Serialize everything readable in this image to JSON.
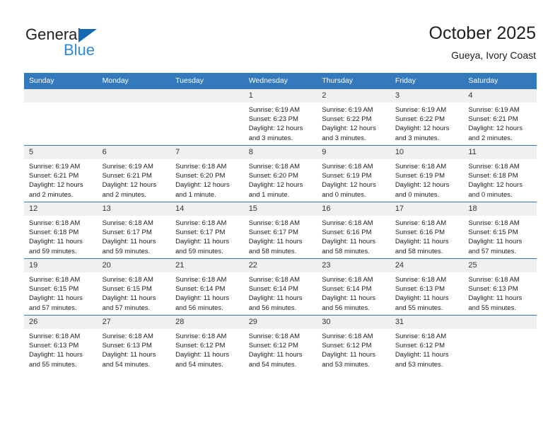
{
  "logo": {
    "line1": "General",
    "line2": "Blue",
    "triangle_color": "#1668b3",
    "line2_color": "#2e8bd8"
  },
  "header": {
    "title": "October 2025",
    "subtitle": "Gueya, Ivory Coast"
  },
  "colors": {
    "header_blue": "#3479bb",
    "daynum_band": "#f0f0f0",
    "text": "#222222"
  },
  "weekday_headers": [
    "Sunday",
    "Monday",
    "Tuesday",
    "Wednesday",
    "Thursday",
    "Friday",
    "Saturday"
  ],
  "labels": {
    "sunrise_prefix": "Sunrise:",
    "sunset_prefix": "Sunset:",
    "daylight_prefix": "Daylight:"
  },
  "weeks": [
    [
      {
        "day": "",
        "empty": true
      },
      {
        "day": "",
        "empty": true
      },
      {
        "day": "",
        "empty": true
      },
      {
        "day": "1",
        "sunrise": "Sunrise: 6:19 AM",
        "sunset": "Sunset: 6:23 PM",
        "daylight_line1": "Daylight: 12 hours",
        "daylight_line2": "and 3 minutes."
      },
      {
        "day": "2",
        "sunrise": "Sunrise: 6:19 AM",
        "sunset": "Sunset: 6:22 PM",
        "daylight_line1": "Daylight: 12 hours",
        "daylight_line2": "and 3 minutes."
      },
      {
        "day": "3",
        "sunrise": "Sunrise: 6:19 AM",
        "sunset": "Sunset: 6:22 PM",
        "daylight_line1": "Daylight: 12 hours",
        "daylight_line2": "and 3 minutes."
      },
      {
        "day": "4",
        "sunrise": "Sunrise: 6:19 AM",
        "sunset": "Sunset: 6:21 PM",
        "daylight_line1": "Daylight: 12 hours",
        "daylight_line2": "and 2 minutes."
      }
    ],
    [
      {
        "day": "5",
        "sunrise": "Sunrise: 6:19 AM",
        "sunset": "Sunset: 6:21 PM",
        "daylight_line1": "Daylight: 12 hours",
        "daylight_line2": "and 2 minutes."
      },
      {
        "day": "6",
        "sunrise": "Sunrise: 6:19 AM",
        "sunset": "Sunset: 6:21 PM",
        "daylight_line1": "Daylight: 12 hours",
        "daylight_line2": "and 2 minutes."
      },
      {
        "day": "7",
        "sunrise": "Sunrise: 6:18 AM",
        "sunset": "Sunset: 6:20 PM",
        "daylight_line1": "Daylight: 12 hours",
        "daylight_line2": "and 1 minute."
      },
      {
        "day": "8",
        "sunrise": "Sunrise: 6:18 AM",
        "sunset": "Sunset: 6:20 PM",
        "daylight_line1": "Daylight: 12 hours",
        "daylight_line2": "and 1 minute."
      },
      {
        "day": "9",
        "sunrise": "Sunrise: 6:18 AM",
        "sunset": "Sunset: 6:19 PM",
        "daylight_line1": "Daylight: 12 hours",
        "daylight_line2": "and 0 minutes."
      },
      {
        "day": "10",
        "sunrise": "Sunrise: 6:18 AM",
        "sunset": "Sunset: 6:19 PM",
        "daylight_line1": "Daylight: 12 hours",
        "daylight_line2": "and 0 minutes."
      },
      {
        "day": "11",
        "sunrise": "Sunrise: 6:18 AM",
        "sunset": "Sunset: 6:18 PM",
        "daylight_line1": "Daylight: 12 hours",
        "daylight_line2": "and 0 minutes."
      }
    ],
    [
      {
        "day": "12",
        "sunrise": "Sunrise: 6:18 AM",
        "sunset": "Sunset: 6:18 PM",
        "daylight_line1": "Daylight: 11 hours",
        "daylight_line2": "and 59 minutes."
      },
      {
        "day": "13",
        "sunrise": "Sunrise: 6:18 AM",
        "sunset": "Sunset: 6:17 PM",
        "daylight_line1": "Daylight: 11 hours",
        "daylight_line2": "and 59 minutes."
      },
      {
        "day": "14",
        "sunrise": "Sunrise: 6:18 AM",
        "sunset": "Sunset: 6:17 PM",
        "daylight_line1": "Daylight: 11 hours",
        "daylight_line2": "and 59 minutes."
      },
      {
        "day": "15",
        "sunrise": "Sunrise: 6:18 AM",
        "sunset": "Sunset: 6:17 PM",
        "daylight_line1": "Daylight: 11 hours",
        "daylight_line2": "and 58 minutes."
      },
      {
        "day": "16",
        "sunrise": "Sunrise: 6:18 AM",
        "sunset": "Sunset: 6:16 PM",
        "daylight_line1": "Daylight: 11 hours",
        "daylight_line2": "and 58 minutes."
      },
      {
        "day": "17",
        "sunrise": "Sunrise: 6:18 AM",
        "sunset": "Sunset: 6:16 PM",
        "daylight_line1": "Daylight: 11 hours",
        "daylight_line2": "and 58 minutes."
      },
      {
        "day": "18",
        "sunrise": "Sunrise: 6:18 AM",
        "sunset": "Sunset: 6:15 PM",
        "daylight_line1": "Daylight: 11 hours",
        "daylight_line2": "and 57 minutes."
      }
    ],
    [
      {
        "day": "19",
        "sunrise": "Sunrise: 6:18 AM",
        "sunset": "Sunset: 6:15 PM",
        "daylight_line1": "Daylight: 11 hours",
        "daylight_line2": "and 57 minutes."
      },
      {
        "day": "20",
        "sunrise": "Sunrise: 6:18 AM",
        "sunset": "Sunset: 6:15 PM",
        "daylight_line1": "Daylight: 11 hours",
        "daylight_line2": "and 57 minutes."
      },
      {
        "day": "21",
        "sunrise": "Sunrise: 6:18 AM",
        "sunset": "Sunset: 6:14 PM",
        "daylight_line1": "Daylight: 11 hours",
        "daylight_line2": "and 56 minutes."
      },
      {
        "day": "22",
        "sunrise": "Sunrise: 6:18 AM",
        "sunset": "Sunset: 6:14 PM",
        "daylight_line1": "Daylight: 11 hours",
        "daylight_line2": "and 56 minutes."
      },
      {
        "day": "23",
        "sunrise": "Sunrise: 6:18 AM",
        "sunset": "Sunset: 6:14 PM",
        "daylight_line1": "Daylight: 11 hours",
        "daylight_line2": "and 56 minutes."
      },
      {
        "day": "24",
        "sunrise": "Sunrise: 6:18 AM",
        "sunset": "Sunset: 6:13 PM",
        "daylight_line1": "Daylight: 11 hours",
        "daylight_line2": "and 55 minutes."
      },
      {
        "day": "25",
        "sunrise": "Sunrise: 6:18 AM",
        "sunset": "Sunset: 6:13 PM",
        "daylight_line1": "Daylight: 11 hours",
        "daylight_line2": "and 55 minutes."
      }
    ],
    [
      {
        "day": "26",
        "sunrise": "Sunrise: 6:18 AM",
        "sunset": "Sunset: 6:13 PM",
        "daylight_line1": "Daylight: 11 hours",
        "daylight_line2": "and 55 minutes."
      },
      {
        "day": "27",
        "sunrise": "Sunrise: 6:18 AM",
        "sunset": "Sunset: 6:13 PM",
        "daylight_line1": "Daylight: 11 hours",
        "daylight_line2": "and 54 minutes."
      },
      {
        "day": "28",
        "sunrise": "Sunrise: 6:18 AM",
        "sunset": "Sunset: 6:12 PM",
        "daylight_line1": "Daylight: 11 hours",
        "daylight_line2": "and 54 minutes."
      },
      {
        "day": "29",
        "sunrise": "Sunrise: 6:18 AM",
        "sunset": "Sunset: 6:12 PM",
        "daylight_line1": "Daylight: 11 hours",
        "daylight_line2": "and 54 minutes."
      },
      {
        "day": "30",
        "sunrise": "Sunrise: 6:18 AM",
        "sunset": "Sunset: 6:12 PM",
        "daylight_line1": "Daylight: 11 hours",
        "daylight_line2": "and 53 minutes."
      },
      {
        "day": "31",
        "sunrise": "Sunrise: 6:18 AM",
        "sunset": "Sunset: 6:12 PM",
        "daylight_line1": "Daylight: 11 hours",
        "daylight_line2": "and 53 minutes."
      },
      {
        "day": "",
        "empty": true
      }
    ]
  ]
}
